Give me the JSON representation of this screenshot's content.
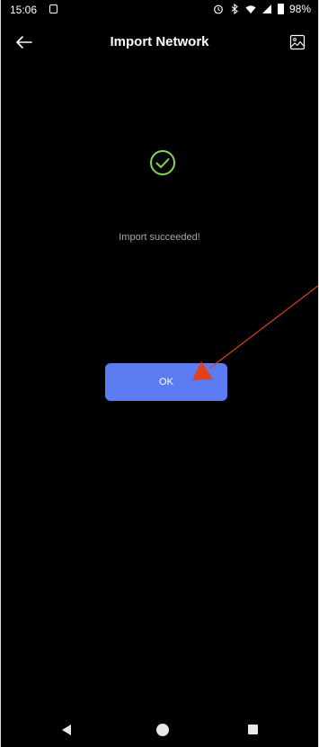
{
  "status_bar": {
    "time": "15:06",
    "battery": "98%",
    "icons": [
      "notification-icon",
      "alarm-icon",
      "bluetooth-icon",
      "wifi-icon",
      "signal-icon",
      "battery-icon"
    ]
  },
  "header": {
    "title": "Import Network",
    "back_icon": "back-arrow-icon",
    "action_icon": "image-icon"
  },
  "content": {
    "icon": "check-circle-icon",
    "message": "Import succeeded!",
    "ok_label": "OK"
  },
  "colors": {
    "background": "#000000",
    "success_green": "#7ed957",
    "button_blue": "#5b7cf2",
    "annotation_red": "#e0401c"
  },
  "nav_bar": {
    "icons": [
      "nav-back-icon",
      "nav-home-icon",
      "nav-recents-icon"
    ]
  }
}
